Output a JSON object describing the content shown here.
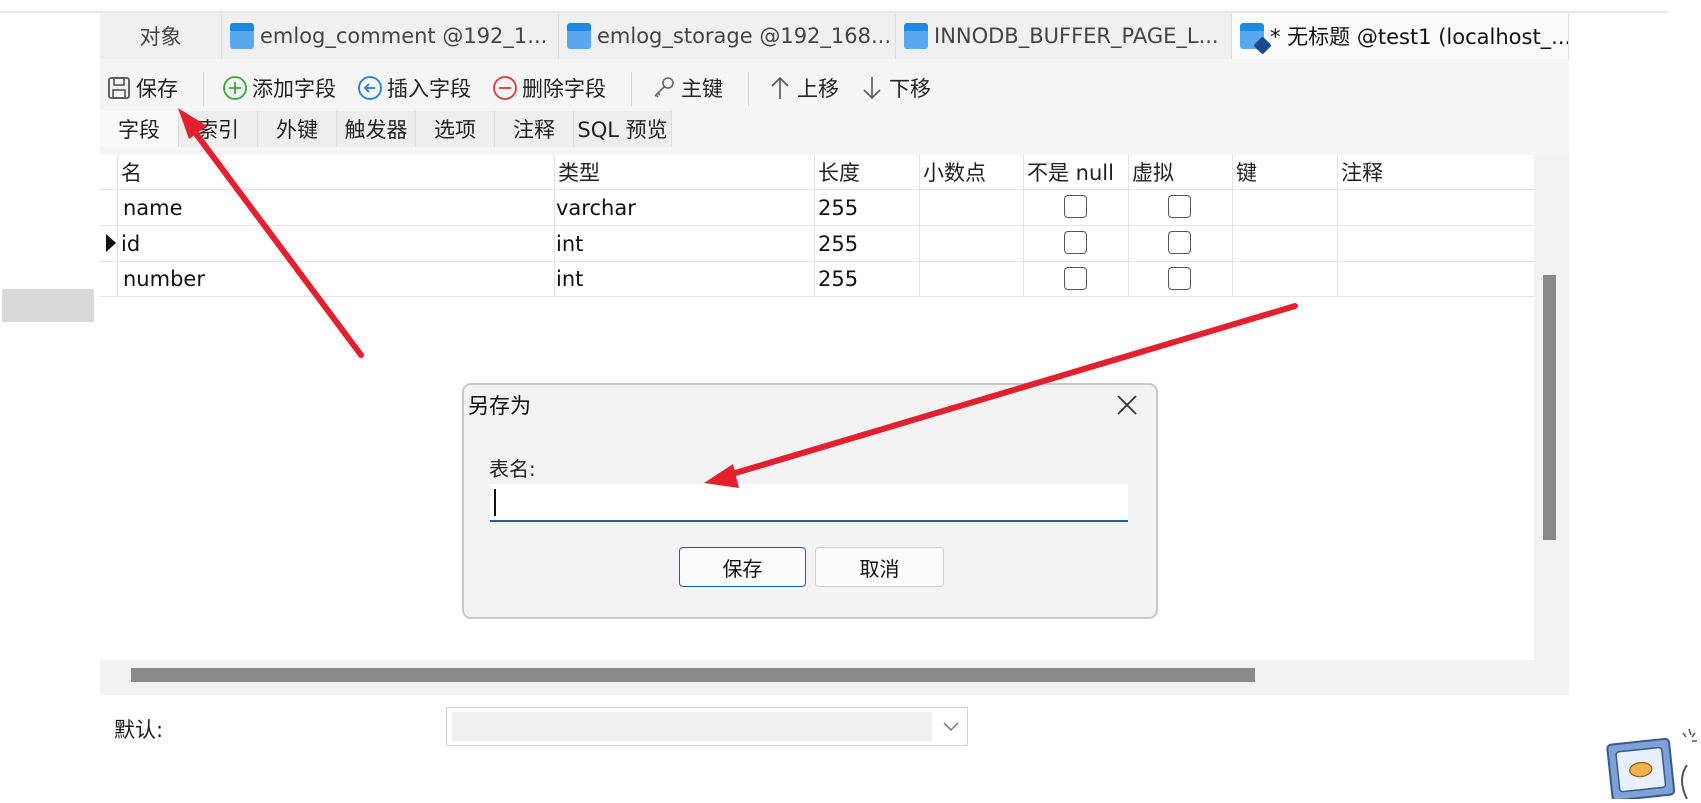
{
  "tabs": [
    {
      "label": "对象"
    },
    {
      "label": "emlog_comment @192_1..."
    },
    {
      "label": "emlog_storage @192_168..."
    },
    {
      "label": "INNODB_BUFFER_PAGE_L..."
    },
    {
      "label": "* 无标题 @test1 (localhost_..."
    }
  ],
  "toolbar": {
    "save": "保存",
    "add_field": "添加字段",
    "insert_field": "插入字段",
    "delete_field": "删除字段",
    "primary_key": "主键",
    "move_up": "上移",
    "move_down": "下移"
  },
  "subtabs": [
    "字段",
    "索引",
    "外键",
    "触发器",
    "选项",
    "注释",
    "SQL 预览"
  ],
  "grid": {
    "columns": [
      "名",
      "类型",
      "长度",
      "小数点",
      "不是 null",
      "虚拟",
      "键",
      "注释"
    ],
    "rows": [
      {
        "name": "name",
        "type": "varchar",
        "length": "255",
        "current": false
      },
      {
        "name": "id",
        "type": "int",
        "length": "255",
        "current": true
      },
      {
        "name": "number",
        "type": "int",
        "length": "255",
        "current": false
      }
    ]
  },
  "bottom": {
    "default_label": "默认:",
    "default_value": ""
  },
  "dialog": {
    "title": "另存为",
    "field_label": "表名:",
    "field_value": "",
    "save": "保存",
    "cancel": "取消"
  },
  "colors": {
    "accent": "#1a5fb4",
    "annotation_arrow": "#e5202e",
    "add_icon": "#3aa63a",
    "insert_icon": "#1e7ed8",
    "delete_icon": "#e0373c"
  }
}
